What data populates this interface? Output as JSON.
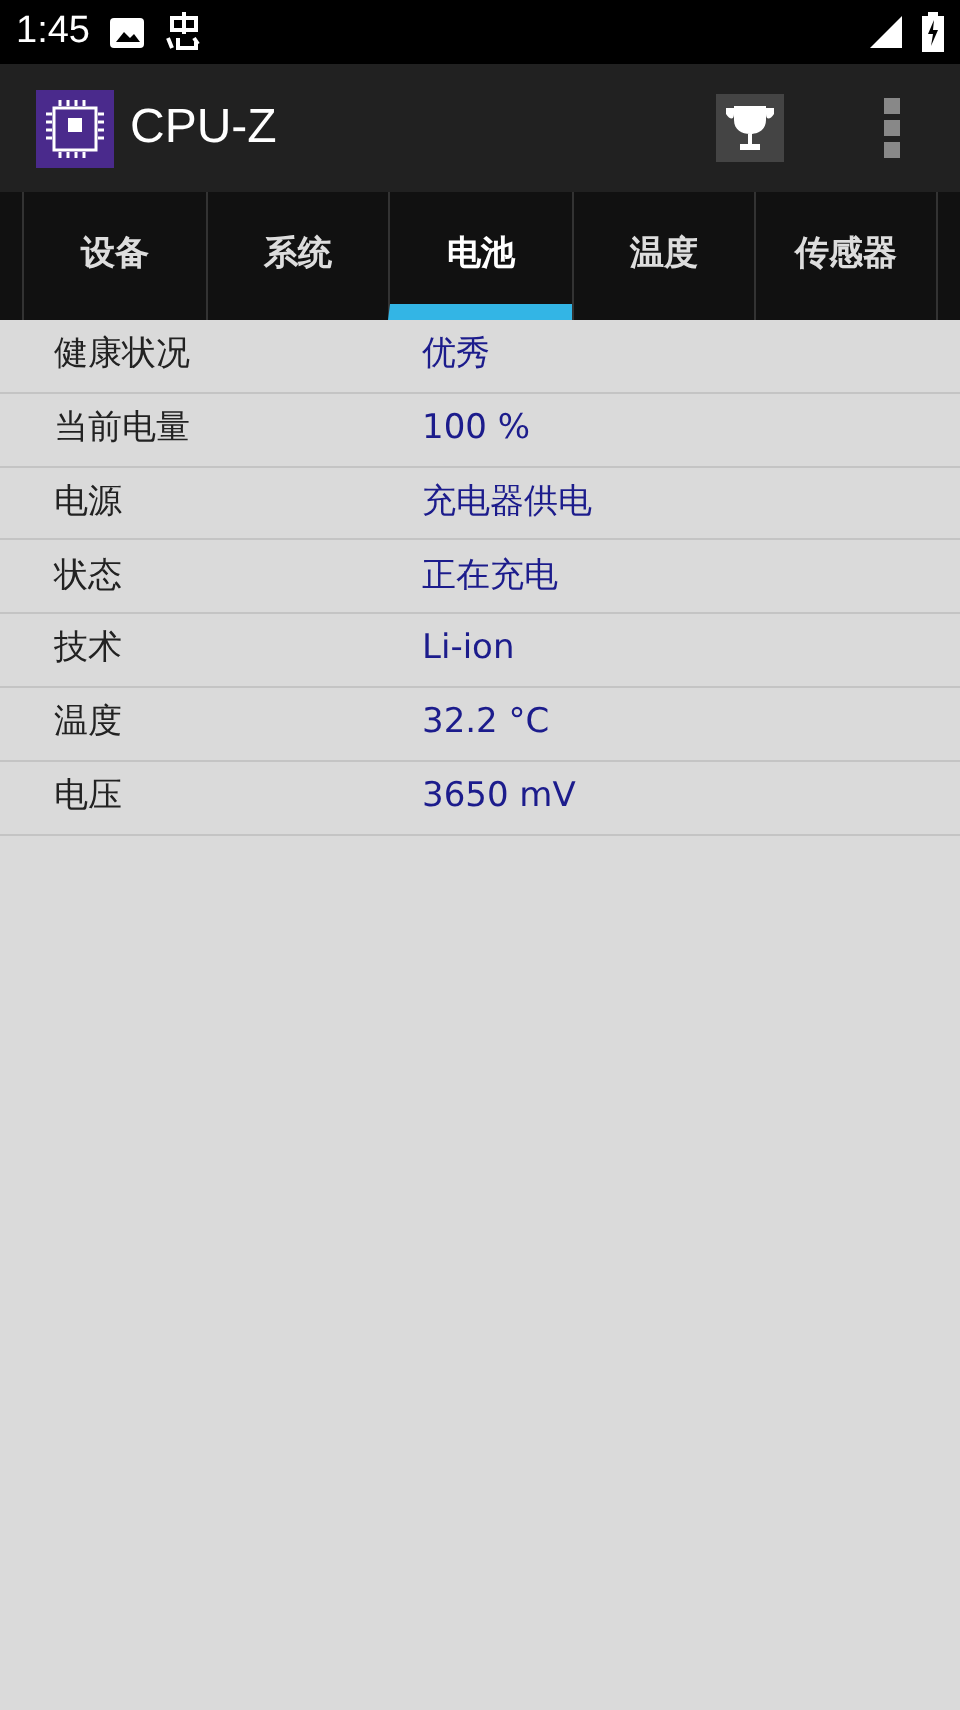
{
  "status_bar": {
    "time": "1:45"
  },
  "app_bar": {
    "title": "CPU-Z"
  },
  "tabs": [
    {
      "label": "设备",
      "selected": false
    },
    {
      "label": "系统",
      "selected": false
    },
    {
      "label": "电池",
      "selected": true
    },
    {
      "label": "温度",
      "selected": false
    },
    {
      "label": "传感器",
      "selected": false
    }
  ],
  "rows": [
    {
      "label": "健康状况",
      "value": "优秀"
    },
    {
      "label": "当前电量",
      "value": "100 %"
    },
    {
      "label": "电源",
      "value": "充电器供电"
    },
    {
      "label": "状态",
      "value": "正在充电"
    },
    {
      "label": "技术",
      "value": "Li-ion"
    },
    {
      "label": "温度",
      "value": "32.2 °C"
    },
    {
      "label": "电压",
      "value": "3650 mV"
    }
  ]
}
